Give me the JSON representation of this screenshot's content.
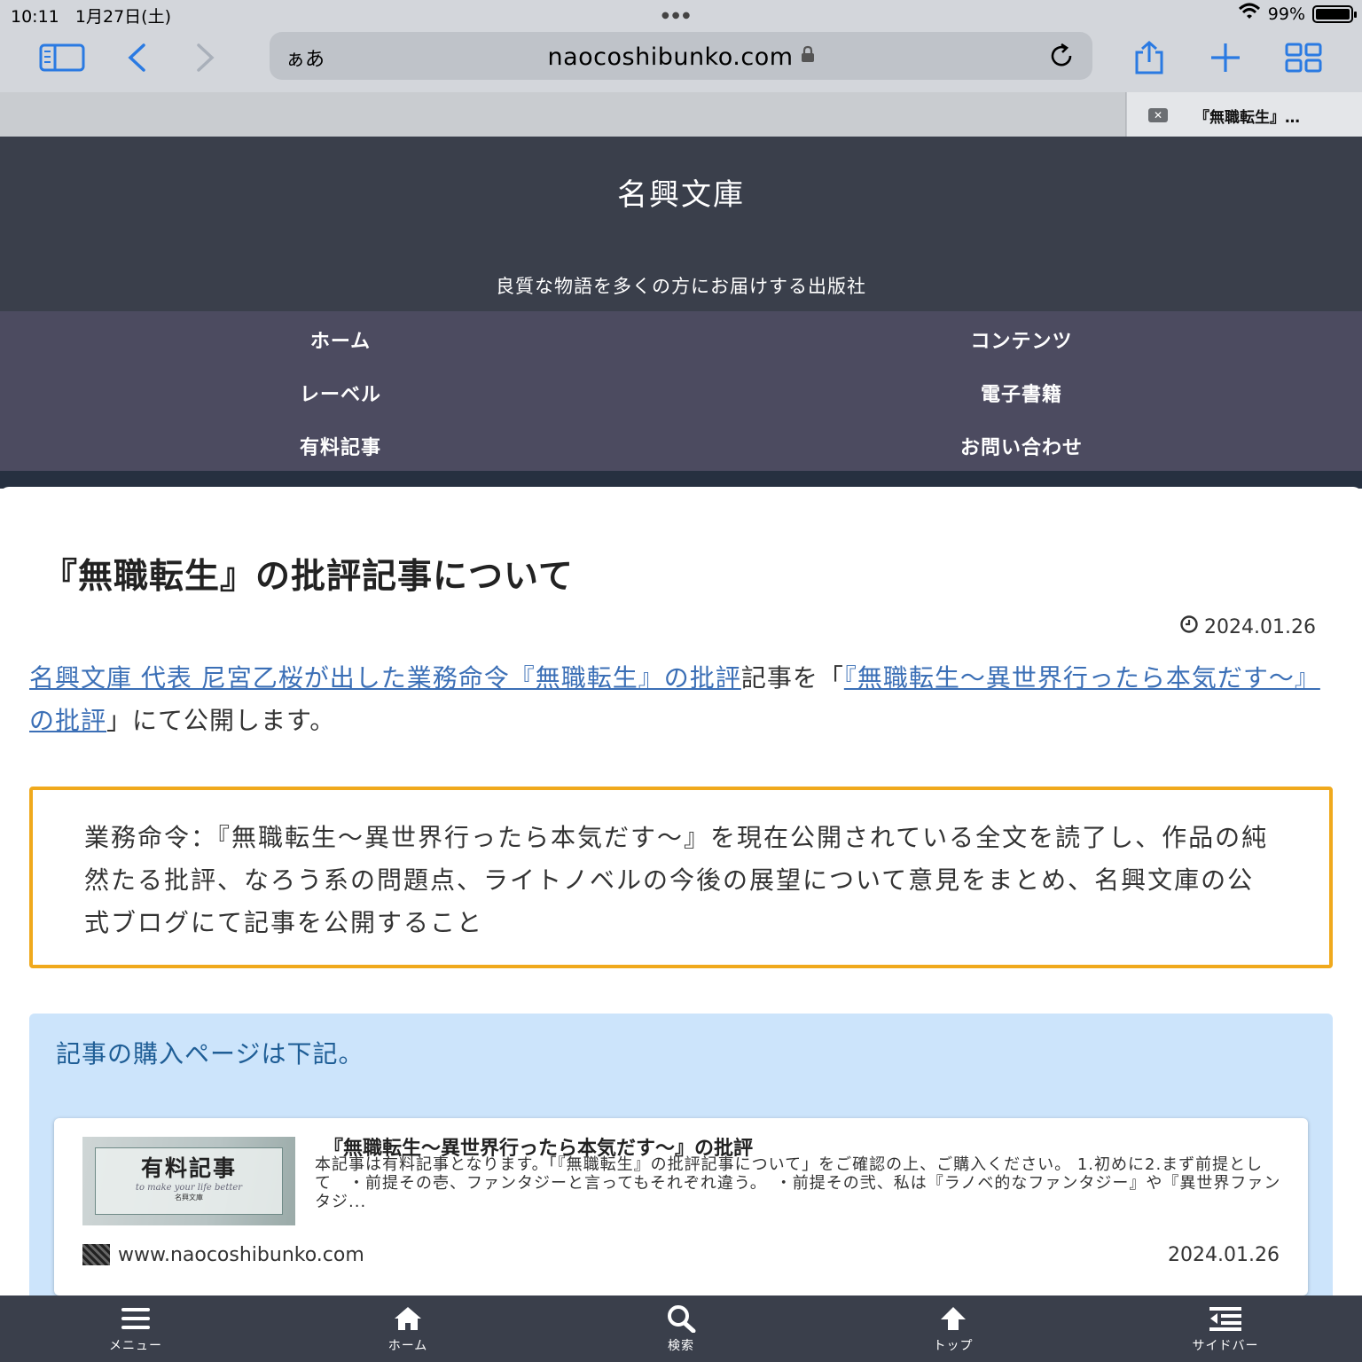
{
  "status_bar": {
    "time": "10:11",
    "date": "1月27日(土)",
    "battery": "99%",
    "battery_level": 0.99
  },
  "browser": {
    "text_size_label": "ぁあ",
    "url": "naocoshibunko.com",
    "tab_title": "『無職転生』…"
  },
  "site": {
    "title": "名興文庫",
    "tagline": "良質な物語を多くの方にお届けする出版社",
    "nav": [
      "ホーム",
      "コンテンツ",
      "レーベル",
      "電子書籍",
      "有料記事",
      "お問い合わせ"
    ]
  },
  "post": {
    "title": "『無職転生』の批評記事について",
    "date": "2024.01.26",
    "intro": {
      "link1": "名興文庫 代表 尼宮乙桜が出した業務命令『無職転生』の批評",
      "text1": "記事を「",
      "link2": "『無職転生～異世界行ったら本気だす～』の批評",
      "text2": "」にて公開します。"
    },
    "order": "業務命令：『無職転生～異世界行ったら本気だす～』を現在公開されている全文を読了し、作品の純然たる批評、なろう系の問題点、ライトノベルの今後の展望について意見をまとめ、名興文庫の公式ブログにて記事を公開すること",
    "purchase_note": "記事の購入ページは下記。",
    "card": {
      "thumb_main": "有料記事",
      "thumb_sub": "to make your life better",
      "thumb_brand": "名興文庫",
      "title": "『無職転生～異世界行ったら本気だす～』の批評",
      "excerpt": "本記事は有料記事となります。「『無職転生』の批評記事について」をご確認の上、ご購入ください。 1.初めに2.まず前提として　・前提その壱、ファンタジーと言ってもそれぞれ違う。　・前提その弐、私は『ラノベ的なファンタジー』や『異世界ファンタジ...",
      "domain": "www.naocoshibunko.com",
      "date": "2024.01.26"
    }
  },
  "bottom_nav": [
    "メニュー",
    "ホーム",
    "検索",
    "トップ",
    "サイドバー"
  ]
}
